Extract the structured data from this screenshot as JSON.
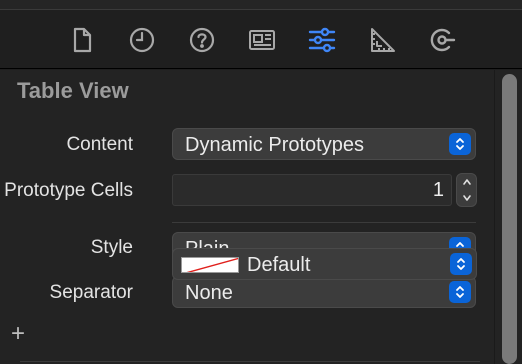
{
  "toolbar": {
    "tools": [
      {
        "name": "file-inspector-icon"
      },
      {
        "name": "history-inspector-icon"
      },
      {
        "name": "quick-help-icon"
      },
      {
        "name": "identity-inspector-icon"
      },
      {
        "name": "attributes-inspector-icon",
        "selected": true
      },
      {
        "name": "size-inspector-icon"
      },
      {
        "name": "connections-inspector-icon"
      }
    ],
    "accent": "#3f86f7"
  },
  "section": {
    "title": "Table View"
  },
  "fields": {
    "content": {
      "label": "Content",
      "value": "Dynamic Prototypes"
    },
    "prototype_cells": {
      "label": "Prototype Cells",
      "value": "1"
    },
    "style": {
      "label": "Style",
      "value": "Plain"
    },
    "separator": {
      "label": "Separator",
      "value": "None"
    },
    "separator_color": {
      "value": "Default",
      "add_label": "+"
    }
  },
  "colors": {
    "popup_chevron": "#0a64d8",
    "background": "#232323"
  }
}
